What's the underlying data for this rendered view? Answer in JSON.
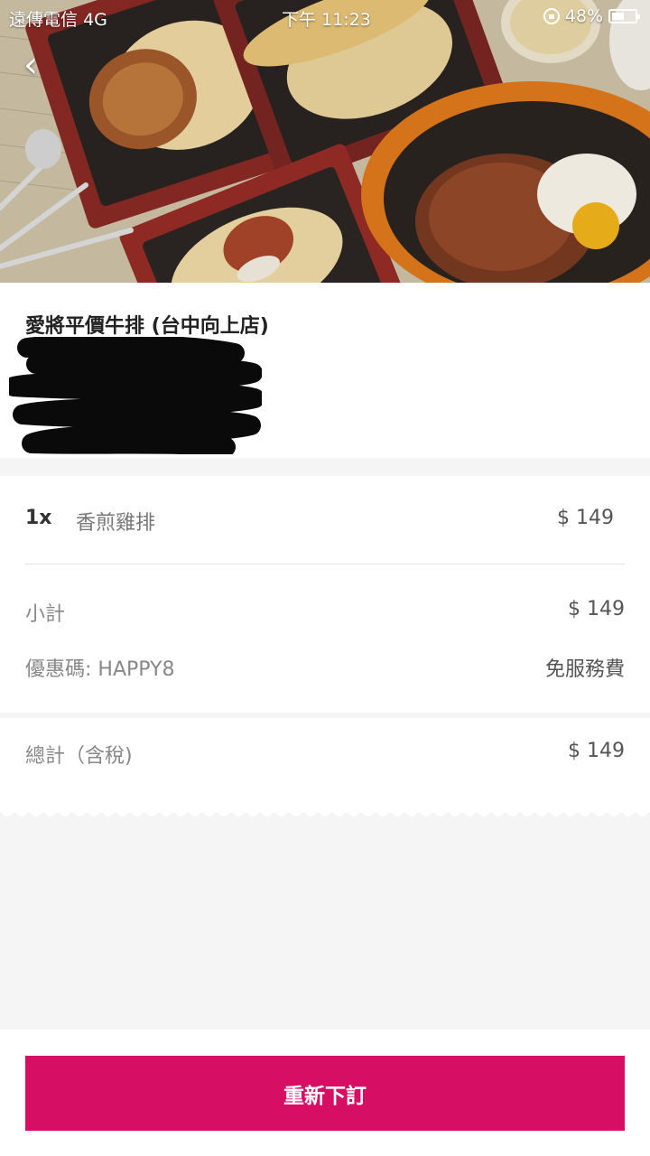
{
  "status_bar": {
    "carrier": "遠傳電信",
    "network": "4G",
    "time": "下午 11:23",
    "battery": "48%"
  },
  "hero": {
    "icon": "chevron-left-icon"
  },
  "restaurant": {
    "name": "愛將平價牛排 (台中向上店)"
  },
  "order": {
    "items": [
      {
        "qty": "1x",
        "name": "香煎雞排",
        "price": "$ 149"
      }
    ],
    "subtotal_label": "小計",
    "subtotal_value": "$ 149",
    "promo_label": "優惠碼: HAPPY8",
    "promo_value": "免服務費",
    "total_label": "總計（含稅)",
    "total_value": "$ 149"
  },
  "actions": {
    "reorder_label": "重新下訂"
  },
  "colors": {
    "accent": "#d70f64"
  }
}
